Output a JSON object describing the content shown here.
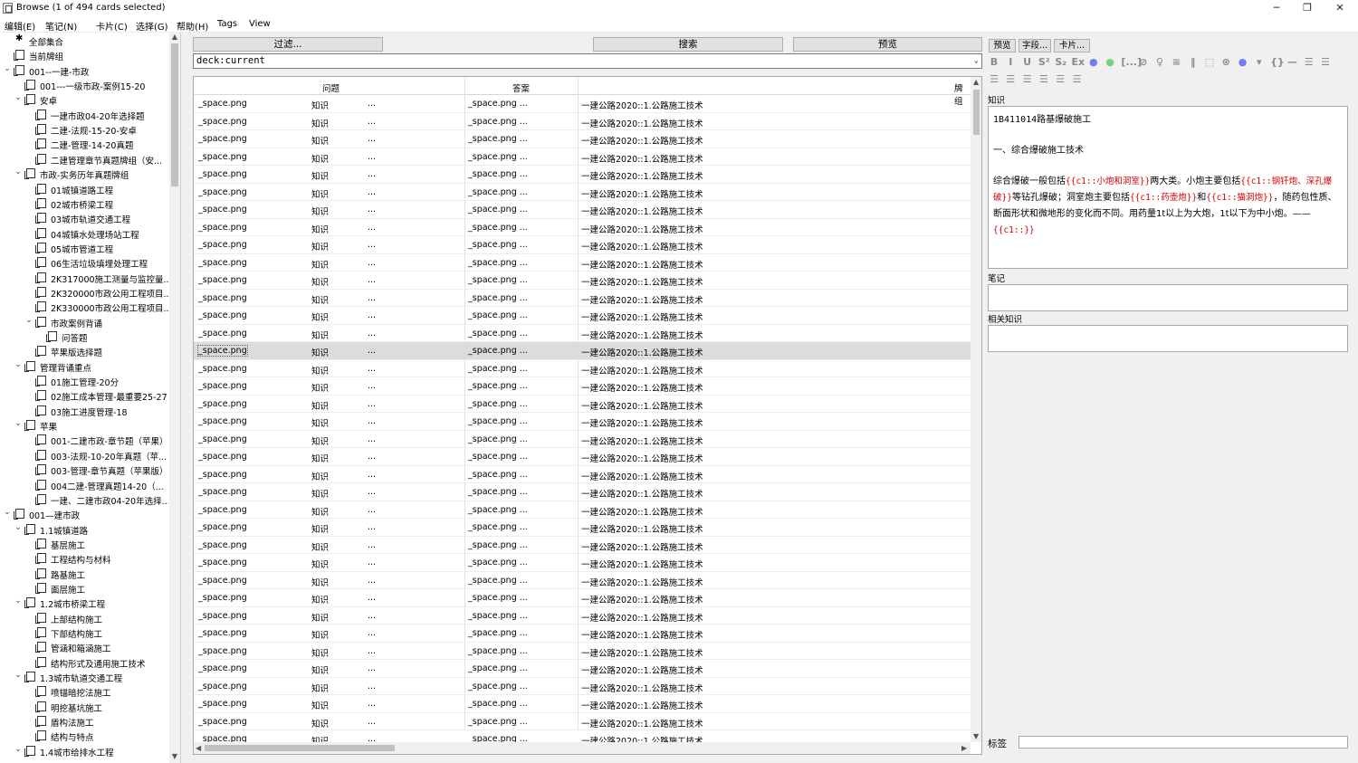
{
  "window": {
    "title": "Browse (1 of 494 cards selected)",
    "minimize": "─",
    "restore": "❐",
    "close": "✕"
  },
  "menu": [
    "编辑(E)",
    "笔记(N)",
    "卡片(C)",
    "选择(G)",
    "帮助(H)",
    "Tags",
    "View"
  ],
  "sidebar": {
    "items": [
      {
        "label": "全部集合",
        "level": 0,
        "caret": "",
        "icon": "star"
      },
      {
        "label": "当前牌组",
        "level": 0,
        "caret": "",
        "icon": "deck"
      },
      {
        "label": "001--一建-市政",
        "level": 0,
        "caret": "⌄",
        "icon": "deck"
      },
      {
        "label": "001---一级市政-案例15-20",
        "level": 1,
        "caret": "",
        "icon": "deck"
      },
      {
        "label": "安卓",
        "level": 1,
        "caret": "⌄",
        "icon": "deck"
      },
      {
        "label": "一建市政04-20年选择题",
        "level": 2,
        "caret": "",
        "icon": "deck"
      },
      {
        "label": "二建-法规-15-20-安卓",
        "level": 2,
        "caret": "",
        "icon": "deck"
      },
      {
        "label": "二建-管理-14-20真题",
        "level": 2,
        "caret": "",
        "icon": "deck"
      },
      {
        "label": "二建管理章节真题牌组（安...",
        "level": 2,
        "caret": "",
        "icon": "deck"
      },
      {
        "label": "市政-实务历年真题牌组",
        "level": 1,
        "caret": "⌄",
        "icon": "deck"
      },
      {
        "label": "01城镇道路工程",
        "level": 2,
        "caret": "",
        "icon": "deck"
      },
      {
        "label": "02城市桥梁工程",
        "level": 2,
        "caret": "",
        "icon": "deck"
      },
      {
        "label": "03城市轨道交通工程",
        "level": 2,
        "caret": "",
        "icon": "deck"
      },
      {
        "label": "04城镇水处理场站工程",
        "level": 2,
        "caret": "",
        "icon": "deck"
      },
      {
        "label": "05城市管道工程",
        "level": 2,
        "caret": "",
        "icon": "deck"
      },
      {
        "label": "06生活垃圾填埋处理工程",
        "level": 2,
        "caret": "",
        "icon": "deck"
      },
      {
        "label": "2K317000施工测量与监控量...",
        "level": 2,
        "caret": "",
        "icon": "deck"
      },
      {
        "label": "2K320000市政公用工程项目...",
        "level": 2,
        "caret": "",
        "icon": "deck"
      },
      {
        "label": "2K330000市政公用工程项目...",
        "level": 2,
        "caret": "",
        "icon": "deck"
      },
      {
        "label": "市政案例背诵",
        "level": 2,
        "caret": "⌄",
        "icon": "deck"
      },
      {
        "label": "问答题",
        "level": 3,
        "caret": "",
        "icon": "deck"
      },
      {
        "label": "苹果版选择题",
        "level": 2,
        "caret": "",
        "icon": "deck"
      },
      {
        "label": "管理背诵重点",
        "level": 1,
        "caret": "⌄",
        "icon": "deck"
      },
      {
        "label": "01施工管理-20分",
        "level": 2,
        "caret": "",
        "icon": "deck"
      },
      {
        "label": "02施工成本管理-最重要25-27",
        "level": 2,
        "caret": "",
        "icon": "deck"
      },
      {
        "label": "03施工进度管理-18",
        "level": 2,
        "caret": "",
        "icon": "deck"
      },
      {
        "label": "苹果",
        "level": 1,
        "caret": "⌄",
        "icon": "deck"
      },
      {
        "label": "001-二建市政-章节题（苹果）",
        "level": 2,
        "caret": "",
        "icon": "deck"
      },
      {
        "label": "003-法规-10-20年真题（苹...",
        "level": 2,
        "caret": "",
        "icon": "deck"
      },
      {
        "label": "003-管理-章节真题（苹果版）",
        "level": 2,
        "caret": "",
        "icon": "deck"
      },
      {
        "label": "004二建-管理真题14-20（...",
        "level": 2,
        "caret": "",
        "icon": "deck"
      },
      {
        "label": "一建、二建市政04-20年选择...",
        "level": 2,
        "caret": "",
        "icon": "deck"
      },
      {
        "label": "001—建市政",
        "level": 0,
        "caret": "⌄",
        "icon": "deck"
      },
      {
        "label": "1.1城镇道路",
        "level": 1,
        "caret": "⌄",
        "icon": "deck"
      },
      {
        "label": "基层施工",
        "level": 2,
        "caret": "",
        "icon": "deck"
      },
      {
        "label": "工程结构与材料",
        "level": 2,
        "caret": "",
        "icon": "deck"
      },
      {
        "label": "路基施工",
        "level": 2,
        "caret": "",
        "icon": "deck"
      },
      {
        "label": "面层施工",
        "level": 2,
        "caret": "",
        "icon": "deck"
      },
      {
        "label": "1.2城市桥梁工程",
        "level": 1,
        "caret": "⌄",
        "icon": "deck"
      },
      {
        "label": "上部结构施工",
        "level": 2,
        "caret": "",
        "icon": "deck"
      },
      {
        "label": "下部结构施工",
        "level": 2,
        "caret": "",
        "icon": "deck"
      },
      {
        "label": "管涵和箱涵施工",
        "level": 2,
        "caret": "",
        "icon": "deck"
      },
      {
        "label": "结构形式及通用施工技术",
        "level": 2,
        "caret": "",
        "icon": "deck"
      },
      {
        "label": "1.3城市轨道交通工程",
        "level": 1,
        "caret": "⌄",
        "icon": "deck"
      },
      {
        "label": "喷锚暗挖法施工",
        "level": 2,
        "caret": "",
        "icon": "deck"
      },
      {
        "label": "明挖基坑施工",
        "level": 2,
        "caret": "",
        "icon": "deck"
      },
      {
        "label": "盾构法施工",
        "level": 2,
        "caret": "",
        "icon": "deck"
      },
      {
        "label": "结构与特点",
        "level": 2,
        "caret": "",
        "icon": "deck"
      },
      {
        "label": "1.4城市给排水工程",
        "level": 1,
        "caret": "⌄",
        "icon": "deck"
      }
    ]
  },
  "toolbar": {
    "filter_label": "过滤...",
    "search_label": "搜索",
    "preview_label": "预览",
    "search_value": "deck:current"
  },
  "table": {
    "headers": [
      "问题",
      "答案",
      "牌组"
    ],
    "row_template": [
      "_space.png",
      "知识",
      "...",
      "_space.png   ...",
      "一建公路2020::1.公路施工技术"
    ],
    "last_row": [
      "_space.png",
      "知识",
      "...",
      "_space.png   ...",
      "一建公路2020::1.公路施工技术"
    ],
    "selected_index": 14
  },
  "editor": {
    "buttons": [
      "预览",
      "字段...",
      "卡片..."
    ],
    "format_icons": [
      "B",
      "I",
      "U",
      "S²",
      "S₂",
      "Ex",
      "●",
      "●",
      "[...]",
      "⊘",
      "♀",
      "≡",
      "‖",
      "⬚",
      "⊛",
      "●",
      "▾",
      "{}",
      "—",
      "☰",
      "☰",
      "☰",
      "☰",
      "☰",
      "☰",
      "☰",
      "☰"
    ],
    "field_knowledge_label": "知识",
    "heading": "1B411014路基爆破施工",
    "subheading": "一、综合爆破施工技术",
    "para_prefix": "综合爆破一般包括",
    "cloze1": "{{c1::小炮和洞室}}",
    "para_mid1": "两大类。小炮主要包括",
    "cloze2": "{{c1::钢钎炮、深孔爆破}}",
    "para_mid2": "等钻孔爆破；洞室炮主要包括",
    "cloze3": "{{c1::药壶炮}}",
    "para_mid3": "和",
    "cloze4": "{{c1::猫洞炮}}",
    "para_mid4": "，随药包性质、断面形状和微地形的变化而不同。用药量1t以上为大炮，1t以下为中小炮。——",
    "cloze5": "{{c1::}}",
    "field_notes_label": "笔记",
    "field_related_label": "相关知识",
    "tags_label": "标签"
  }
}
